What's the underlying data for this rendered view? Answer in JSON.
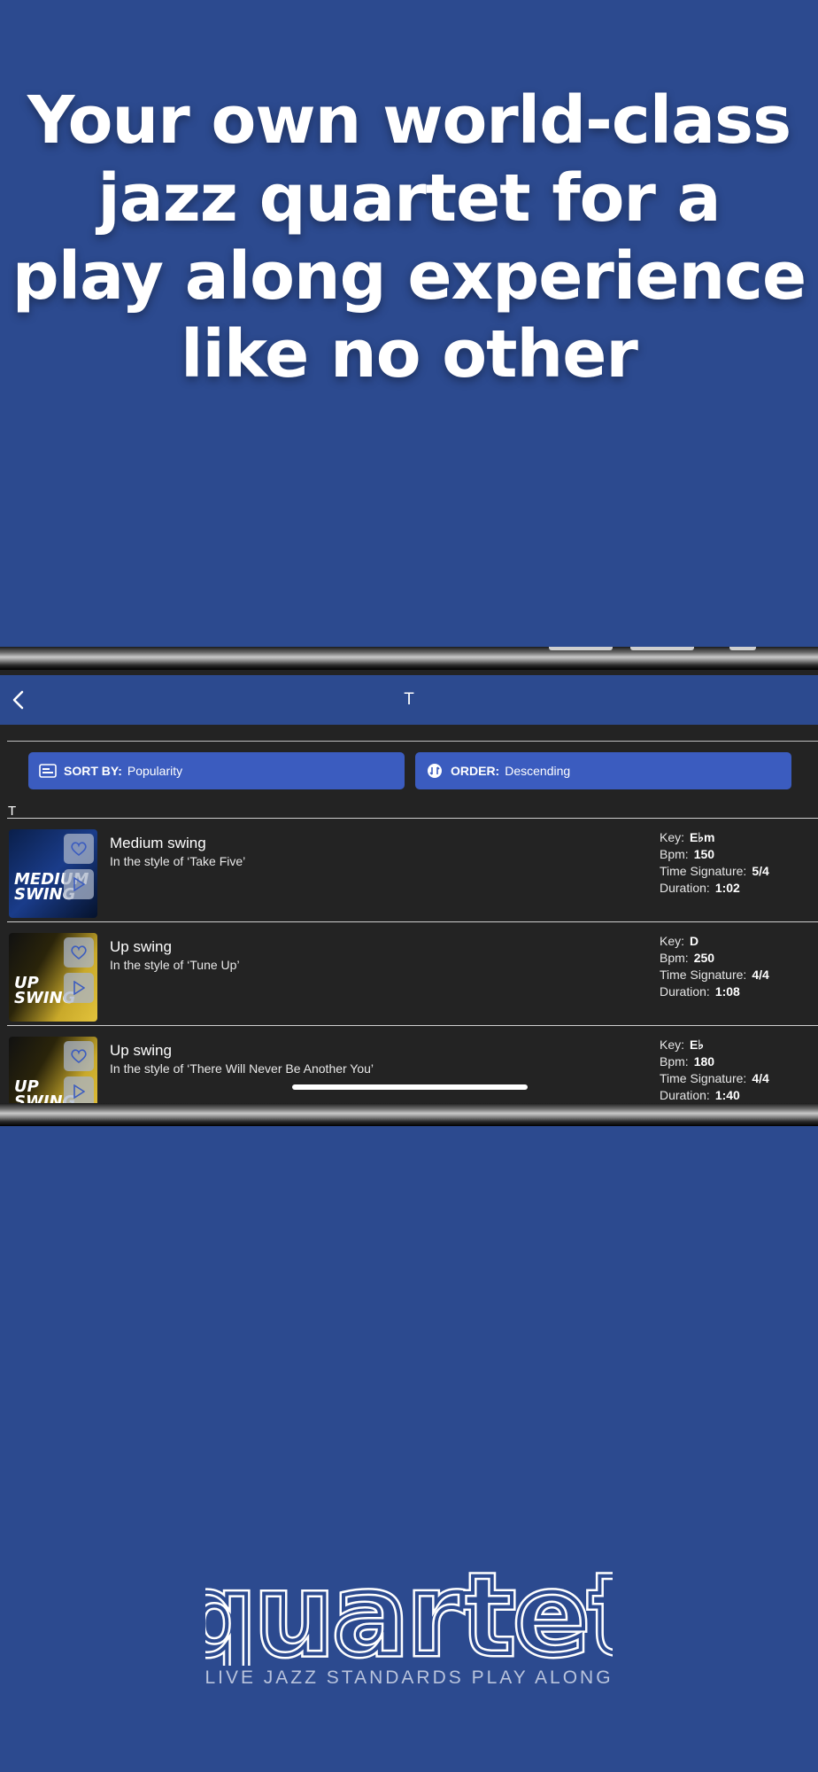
{
  "headline": {
    "line1": "Your own world-class",
    "line2": "jazz quartet for a",
    "line3": "play along experience",
    "line4": "like no other"
  },
  "nav": {
    "title": "T",
    "back_icon": "chevron-left-icon"
  },
  "filters": {
    "sort_key": "SORT BY:",
    "sort_value": "Popularity",
    "order_key": "ORDER:",
    "order_value": "Descending"
  },
  "section_letter": "T",
  "tracks": [
    {
      "title": "Medium swing",
      "subtitle": "In the style of ‘Take Five’",
      "key": "E♭m",
      "bpm": "150",
      "time_signature": "5/4",
      "duration": "1:02",
      "art_text": "MEDIUM SWING"
    },
    {
      "title": "Up swing",
      "subtitle": "In the style of ‘Tune Up’",
      "key": "D",
      "bpm": "250",
      "time_signature": "4/4",
      "duration": "1:08",
      "art_text": "UP SWING"
    },
    {
      "title": "Up swing",
      "subtitle": "In the style of ‘There Will Never Be Another You’",
      "key": "E♭",
      "bpm": "180",
      "time_signature": "4/4",
      "duration": "1:40",
      "art_text": "UP SWING"
    }
  ],
  "labels": {
    "key": "Key:",
    "bpm": "Bpm:",
    "time_signature": "Time Signature:",
    "duration": "Duration:"
  },
  "brand": {
    "logo_text": "quartet",
    "tagline": "LIVE JAZZ STANDARDS PLAY ALONG"
  },
  "colors": {
    "background": "#2c4a8f",
    "button": "#3b5cbf",
    "screen": "#232323"
  }
}
